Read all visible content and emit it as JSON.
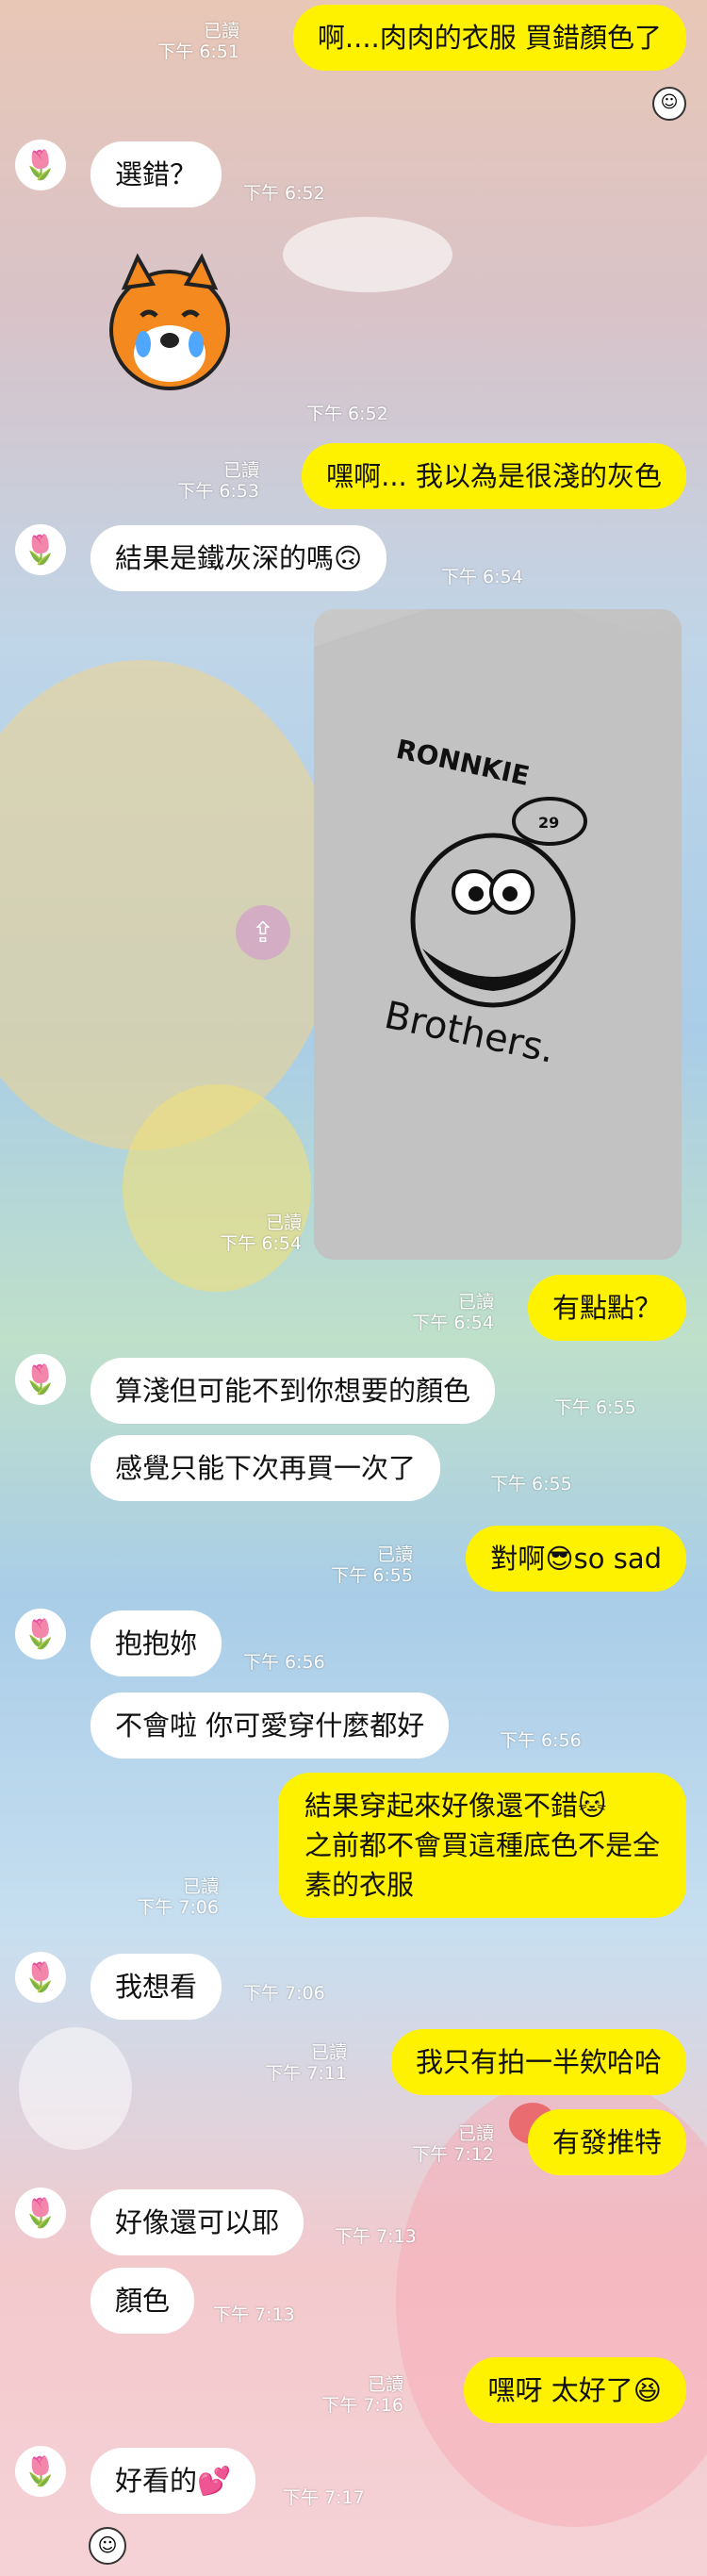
{
  "messages": [
    {
      "side": "out",
      "text": "啊....肉肉的衣服 買錯顏色了",
      "read": "已讀",
      "time": "下午 6:51"
    },
    {
      "side": "in",
      "text": "選錯？",
      "time": "下午 6:52"
    },
    {
      "side": "in",
      "sticker": "crying-hamster-sticker",
      "time": "下午 6:52"
    },
    {
      "side": "out",
      "text": "嘿啊... 我以為是很淺的灰色",
      "read": "已讀",
      "time": "下午 6:53"
    },
    {
      "side": "in",
      "text": "結果是鐵灰深的嗎🙃",
      "time": "下午 6:54"
    },
    {
      "side": "in",
      "photo_text_top": "RONNKIE",
      "photo_text_bottom": "Brothers.",
      "photo_cap_number": "29",
      "read": "已讀",
      "time": "下午 6:54"
    },
    {
      "side": "out",
      "text": "有點點？",
      "read": "已讀",
      "time": "下午 6:54"
    },
    {
      "side": "in",
      "text": "算淺但可能不到你想要的顏色",
      "time": "下午 6:55"
    },
    {
      "side": "in",
      "text": "感覺只能下次再買一次了",
      "time": "下午 6:55"
    },
    {
      "side": "out",
      "text": "對啊😎so sad",
      "read": "已讀",
      "time": "下午 6:55"
    },
    {
      "side": "in",
      "text": "抱抱妳",
      "time": "下午 6:56"
    },
    {
      "side": "in",
      "text": "不會啦 你可愛穿什麼都好",
      "time": "下午 6:56"
    },
    {
      "side": "out",
      "line1": "結果穿起來好像還不錯🐱",
      "line2": "之前都不會買這種底色不是全",
      "line3": "素的衣服",
      "read": "已讀",
      "time": "下午 7:06"
    },
    {
      "side": "in",
      "text": "我想看",
      "time": "下午 7:06"
    },
    {
      "side": "out",
      "text": "我只有拍一半欸哈哈",
      "read": "已讀",
      "time": "下午 7:11"
    },
    {
      "side": "out",
      "text": "有發推特",
      "read": "已讀",
      "time": "下午 7:12"
    },
    {
      "side": "in",
      "text": "好像還可以耶",
      "time": "下午 7:13"
    },
    {
      "side": "in",
      "text": "顏色",
      "time": "下午 7:13"
    },
    {
      "side": "out",
      "text": "嘿呀 太好了😆",
      "read": "已讀",
      "time": "下午 7:16"
    },
    {
      "side": "in",
      "text": "好看的💕",
      "time": "下午 7:17"
    }
  ]
}
